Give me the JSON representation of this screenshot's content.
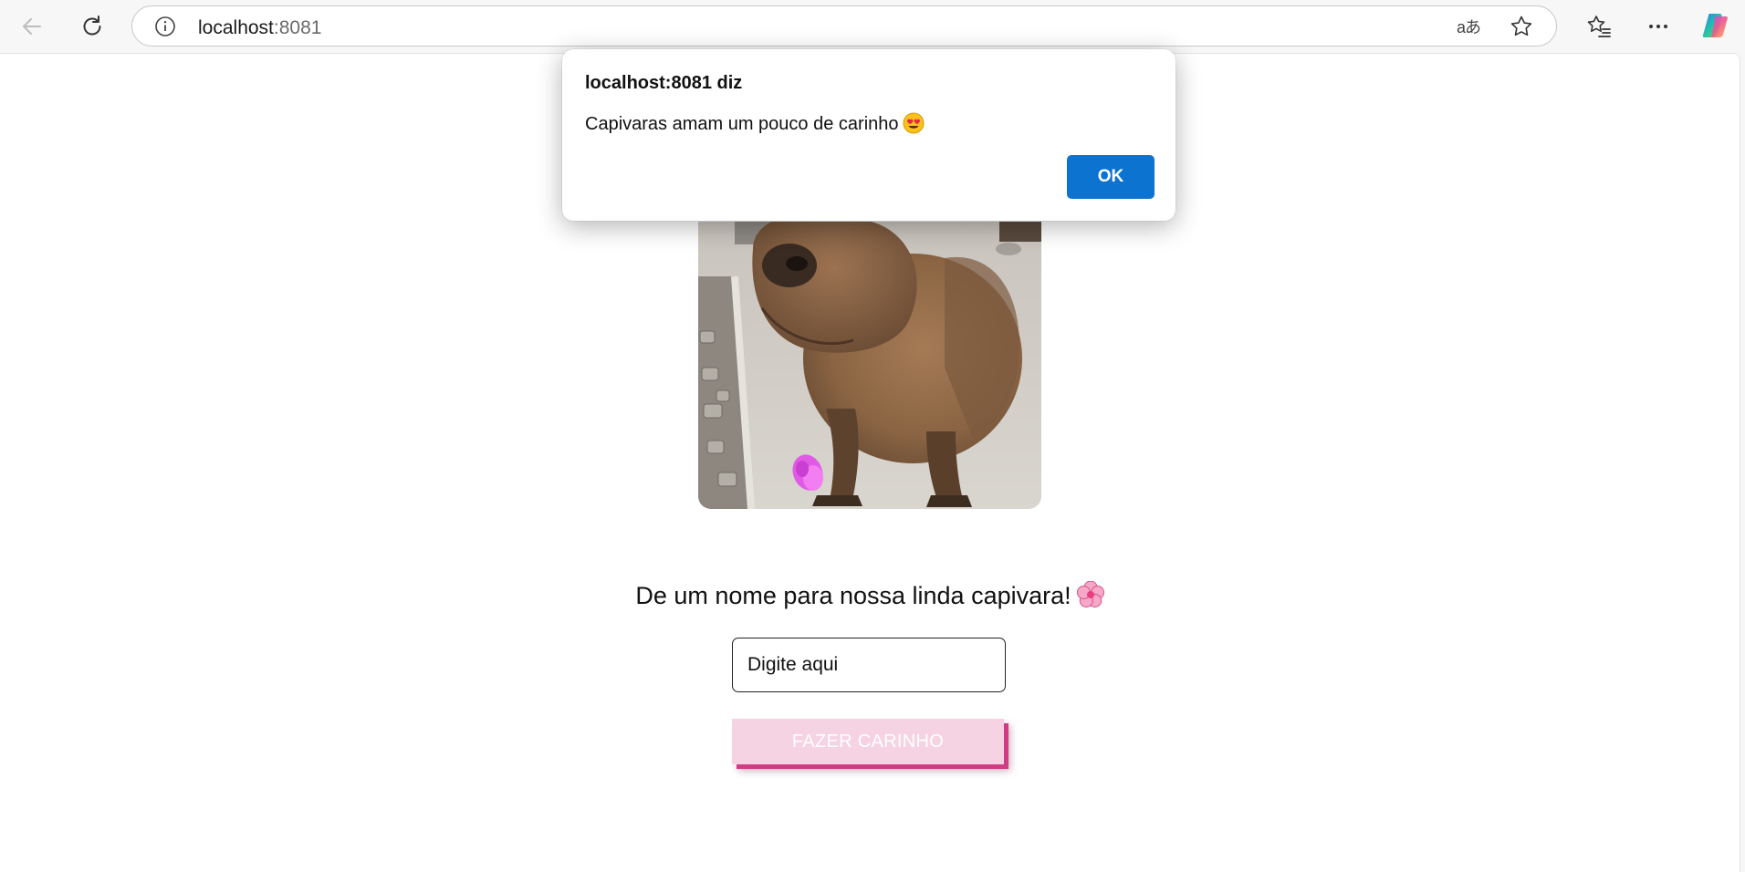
{
  "browser": {
    "url_host": "localhost",
    "url_port": ":8081",
    "icons": {
      "back": "back-arrow-icon",
      "refresh": "refresh-icon",
      "info": "info-icon",
      "translate": "translate-icon",
      "favorite": "star-icon",
      "favorites": "favorites-list-icon",
      "more": "more-icon",
      "copilot": "copilot-icon"
    },
    "translate_glyph": "aあ"
  },
  "page": {
    "image_alt": "capybara with a pink flower",
    "prompt": "De um nome para nossa linda capivara!",
    "prompt_emoji": "flower-emoji",
    "input_placeholder": "Digite aqui",
    "button_label": "FAZER CARINHO"
  },
  "dialog": {
    "title": "localhost:8081 diz",
    "message": "Capivaras amam um pouco de carinho",
    "message_emoji": "smiling-face-with-heart-eyes-emoji",
    "ok_label": "OK"
  },
  "colors": {
    "button_bg": "#f6d3e2",
    "button_shadow": "#d23c84",
    "ok_bg": "#0c73d0"
  }
}
